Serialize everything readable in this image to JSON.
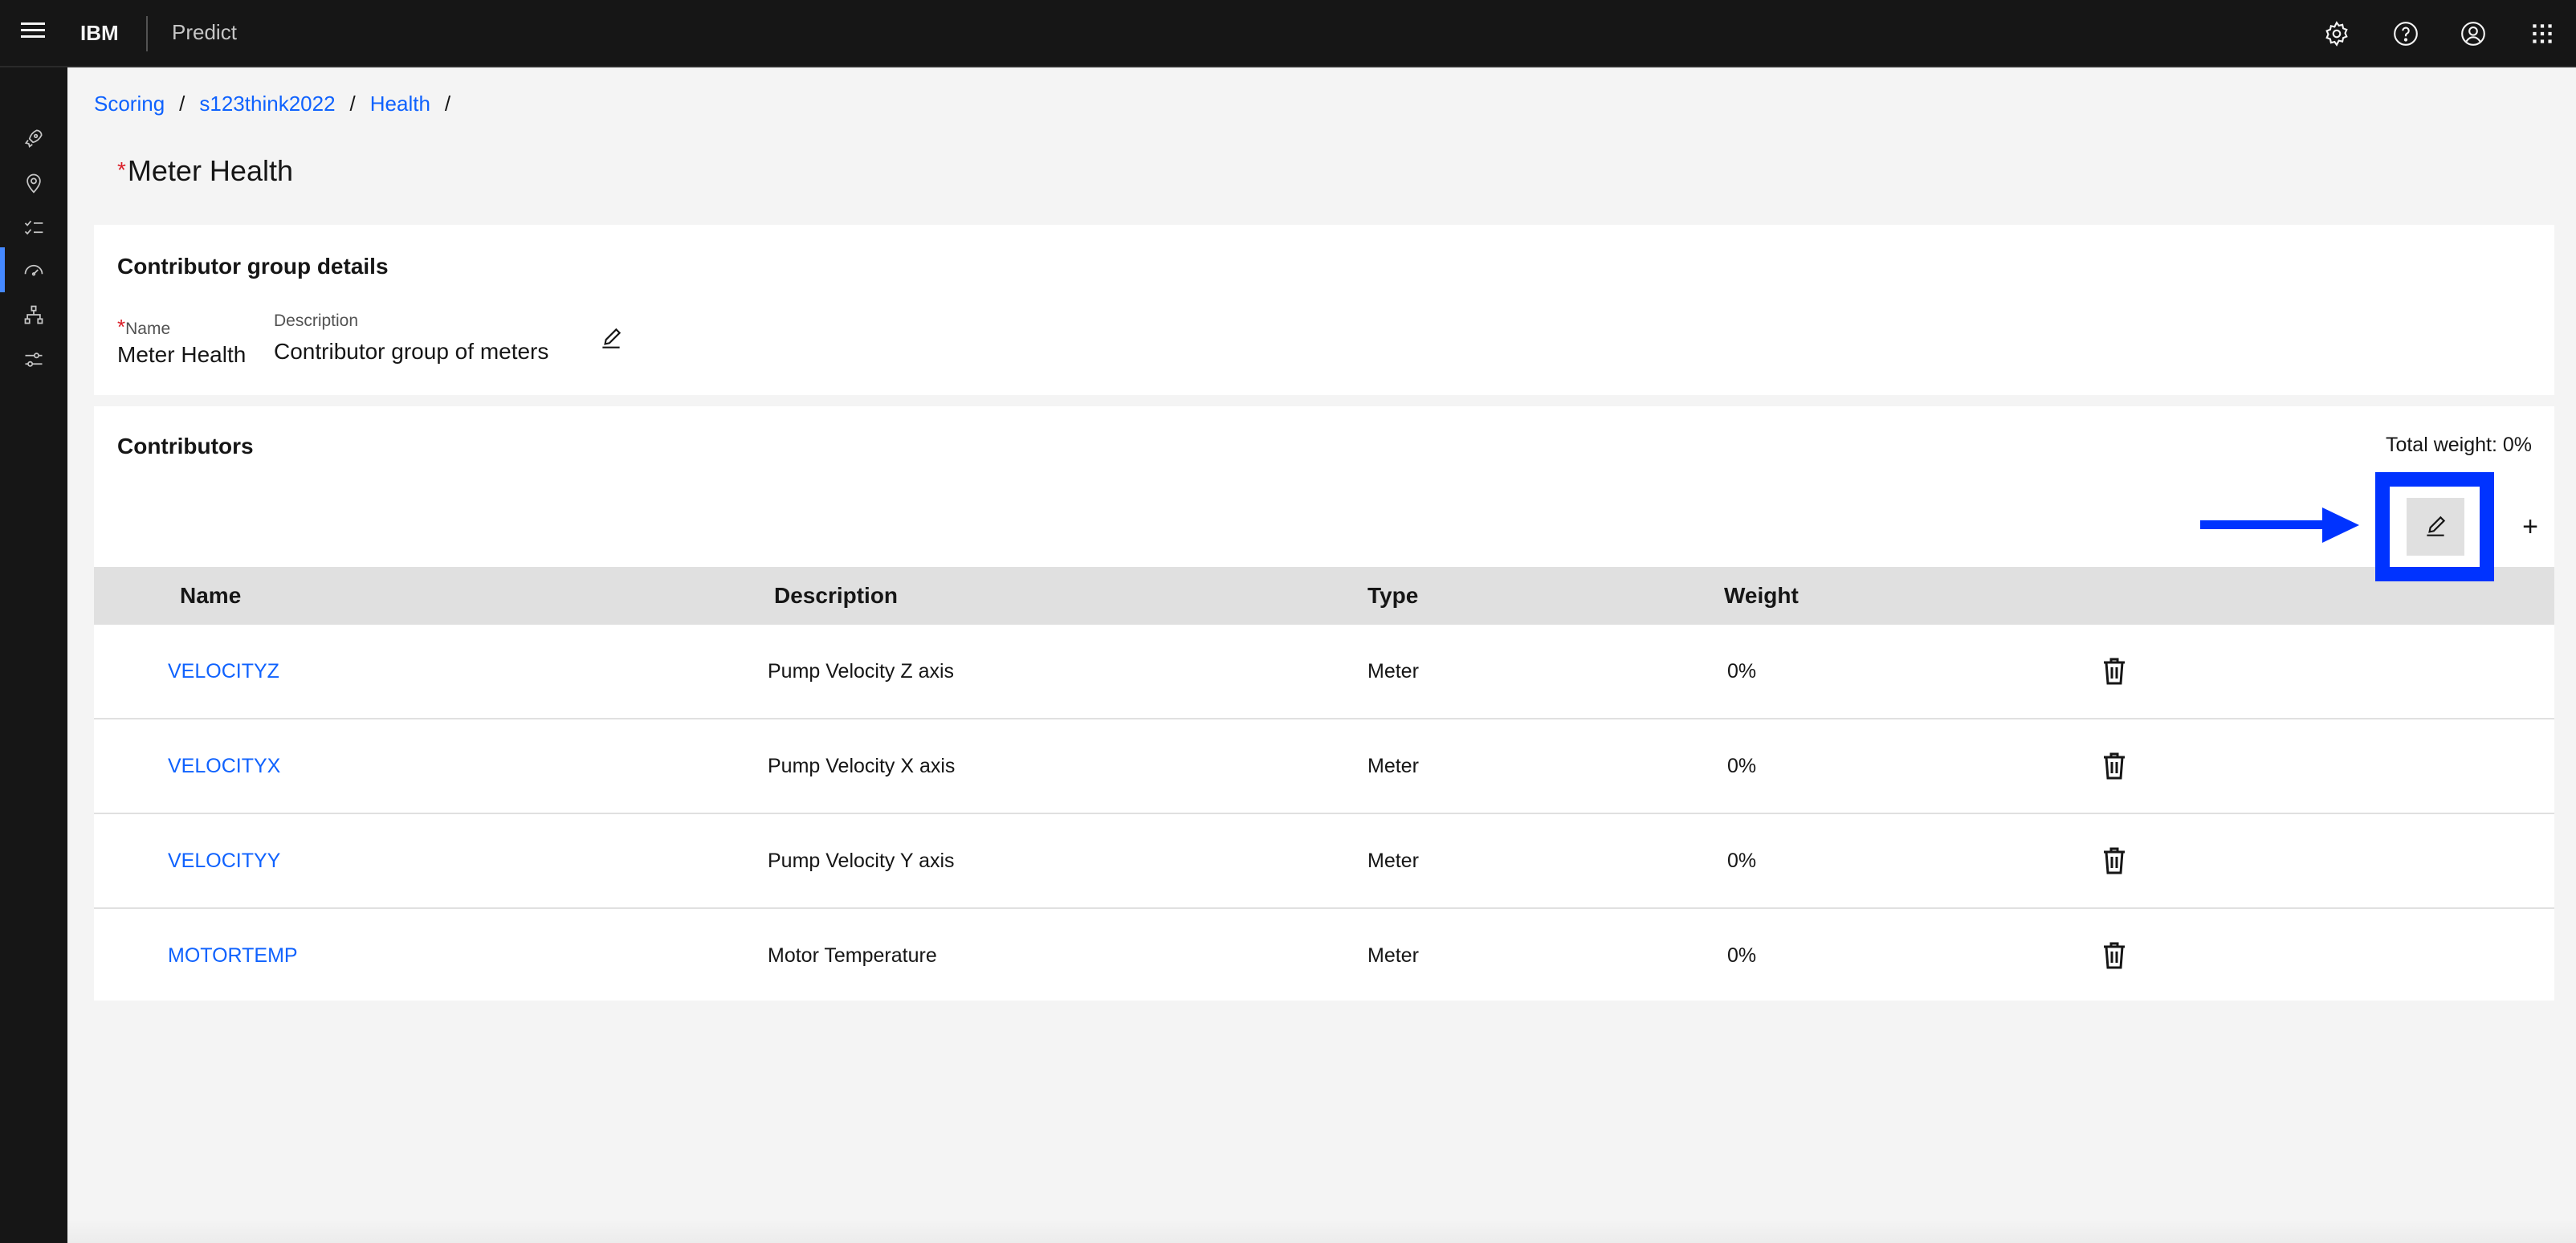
{
  "header": {
    "brand": "IBM",
    "product": "Predict",
    "icons": [
      "settings-icon",
      "help-icon",
      "user-avatar-icon",
      "app-switcher-icon"
    ]
  },
  "rail": {
    "items": [
      {
        "name": "rocket-icon"
      },
      {
        "name": "location-icon"
      },
      {
        "name": "checklist-icon"
      },
      {
        "name": "dashboard-gauge-icon",
        "active": true
      },
      {
        "name": "hierarchy-icon"
      },
      {
        "name": "settings-adjust-icon"
      }
    ]
  },
  "breadcrumb": {
    "items": [
      "Scoring",
      "s123think2022",
      "Health"
    ],
    "separator": "/"
  },
  "page": {
    "required_mark": "*",
    "title": "Meter Health"
  },
  "details": {
    "title": "Contributor group details",
    "name_label": "Name",
    "name_required": "*",
    "name_value": "Meter Health",
    "description_label": "Description",
    "description_value": "Contributor group of meters"
  },
  "contributors": {
    "title": "Contributors",
    "total_weight": "Total weight: 0%",
    "add_symbol": "+",
    "columns": [
      "Name",
      "Description",
      "Type",
      "Weight"
    ],
    "rows": [
      {
        "name": "VELOCITYZ",
        "description": "Pump Velocity Z axis",
        "type": "Meter",
        "weight": "0%"
      },
      {
        "name": "VELOCITYX",
        "description": "Pump Velocity X axis",
        "type": "Meter",
        "weight": "0%"
      },
      {
        "name": "VELOCITYY",
        "description": "Pump Velocity Y axis",
        "type": "Meter",
        "weight": "0%"
      },
      {
        "name": "MOTORTEMP",
        "description": "Motor Temperature",
        "type": "Meter",
        "weight": "0%"
      }
    ]
  },
  "colors": {
    "header_bg": "#161616",
    "link": "#0f62fe",
    "required": "#da1e28",
    "highlight": "#0033ff"
  }
}
